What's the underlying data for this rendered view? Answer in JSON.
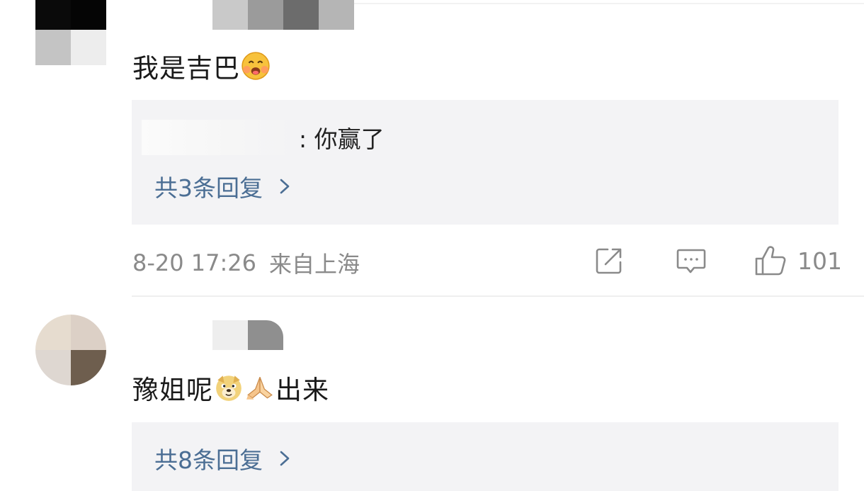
{
  "comments": [
    {
      "text": "我是吉巴",
      "emoji": "blushing-smile-emoji",
      "reply_preview": ": 你赢了",
      "more_replies": "共3条回复",
      "time": "8-20 17:26",
      "location": "来自上海",
      "like_count": "101"
    },
    {
      "text": "豫姐呢",
      "emojis": [
        "doge-emoji",
        "praying-hands-emoji"
      ],
      "text_after": "出来",
      "more_replies": "共8条回复"
    }
  ],
  "colors": {
    "link": "#4b6e94",
    "meta": "#8a8a8a",
    "reply_bg": "#f3f3f5"
  },
  "icons": [
    "share-icon",
    "comment-icon",
    "like-icon",
    "chevron-right-icon"
  ]
}
